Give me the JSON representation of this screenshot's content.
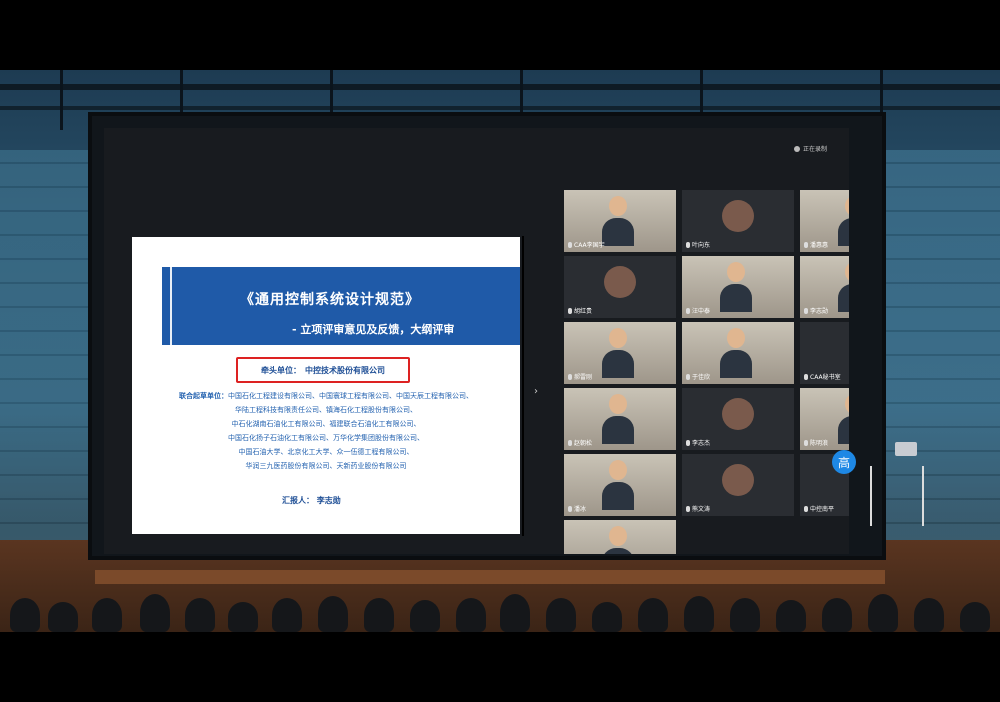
{
  "slide": {
    "title": "《通用控制系统设计规范》",
    "subtitle": "- 立项评审意见及反馈，大纲评审",
    "lead_unit_label": "牵头单位：",
    "lead_unit": "中控技术股份有限公司",
    "drafters_label": "联合起草单位：",
    "drafters": [
      "中国石化工程建设有限公司、中国寰球工程有限公司、中国天辰工程有限公司、",
      "华陆工程科技有限责任公司、镇海石化工程股份有限公司、",
      "中石化湖南石油化工有限公司、福建联合石油化工有限公司、",
      "中国石化扬子石油化工有限公司、万华化学集团股份有限公司、",
      "中国石油大学、北京化工大学、众一伍德工程有限公司、",
      "华润三九医药股份有限公司、天新药业股份有限公司"
    ],
    "reporter_label": "汇报人：",
    "reporter": "李志勋"
  },
  "meeting": {
    "recording_label": "正在录制",
    "speaker_button": "高",
    "participants": [
      {
        "name": "CAA李国宇",
        "style": "video"
      },
      {
        "name": "叶向东",
        "style": "avatar"
      },
      {
        "name": "潘惠惠",
        "style": "video"
      },
      {
        "name": "胡红贵",
        "style": "avatar"
      },
      {
        "name": "汪中泰",
        "style": "video"
      },
      {
        "name": "李志勋",
        "style": "video"
      },
      {
        "name": "郝雷刚",
        "style": "video"
      },
      {
        "name": "于佳欣",
        "style": "video"
      },
      {
        "name": "CAA秘书室",
        "style": "dark"
      },
      {
        "name": "赵朝松",
        "style": "video"
      },
      {
        "name": "李志杰",
        "style": "avatar"
      },
      {
        "name": "陈明浪",
        "style": "video"
      },
      {
        "name": "潘冰",
        "style": "video"
      },
      {
        "name": "熊文涛",
        "style": "avatar"
      },
      {
        "name": "中控南平",
        "style": "dark"
      },
      {
        "name": "",
        "style": "video"
      }
    ]
  }
}
